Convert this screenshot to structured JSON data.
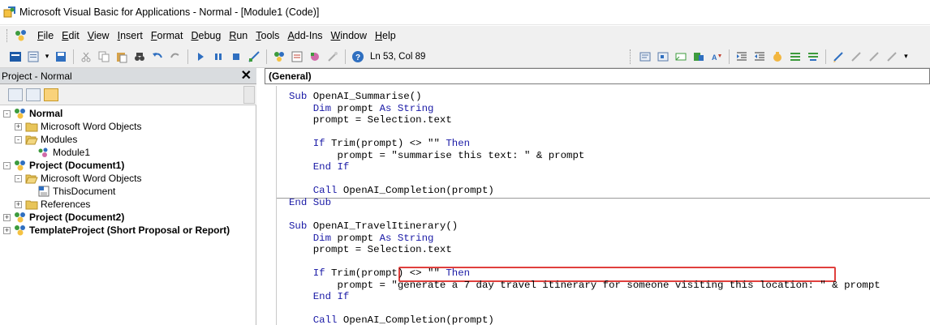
{
  "window": {
    "title": "Microsoft Visual Basic for Applications - Normal - [Module1 (Code)]"
  },
  "menu": {
    "items": [
      "File",
      "Edit",
      "View",
      "Insert",
      "Format",
      "Debug",
      "Run",
      "Tools",
      "Add-Ins",
      "Window",
      "Help"
    ]
  },
  "toolbar": {
    "position": "Ln 53, Col 89"
  },
  "project_pane": {
    "title": "Project - Normal",
    "tree": [
      {
        "label": "Normal",
        "bold": true,
        "expander": "-",
        "icon": "project-icon"
      },
      {
        "label": "Microsoft Word Objects",
        "bold": false,
        "expander": "+",
        "icon": "folder-icon"
      },
      {
        "label": "Modules",
        "bold": false,
        "expander": "-",
        "icon": "open-folder-icon"
      },
      {
        "label": "Module1",
        "bold": false,
        "expander": "",
        "icon": "module-icon"
      },
      {
        "label": "Project (Document1)",
        "bold": true,
        "expander": "-",
        "icon": "project-icon"
      },
      {
        "label": "Microsoft Word Objects",
        "bold": false,
        "expander": "-",
        "icon": "open-folder-icon"
      },
      {
        "label": "ThisDocument",
        "bold": false,
        "expander": "",
        "icon": "document-icon"
      },
      {
        "label": "References",
        "bold": false,
        "expander": "+",
        "icon": "folder-icon"
      },
      {
        "label": "Project (Document2)",
        "bold": true,
        "expander": "+",
        "icon": "project-icon"
      },
      {
        "label": "TemplateProject (Short Proposal or Report)",
        "bold": true,
        "expander": "+",
        "icon": "project-icon"
      }
    ]
  },
  "code_pane": {
    "object_dropdown": "(General)",
    "lines": [
      {
        "kw": "Sub",
        "rest": " OpenAI_Summarise()"
      },
      {
        "pre": "    ",
        "kw": "Dim",
        "rest": " prompt ",
        "kw2": "As String"
      },
      {
        "pre": "    ",
        "rest": "prompt = Selection.text"
      },
      {
        "rest": ""
      },
      {
        "pre": "    ",
        "kw": "If",
        "rest": " Trim(prompt) <> \"\" ",
        "kw2": "Then"
      },
      {
        "pre": "        ",
        "rest": "prompt = \"summarise this text: \" & prompt"
      },
      {
        "pre": "    ",
        "kw": "End If",
        "rest": ""
      },
      {
        "rest": ""
      },
      {
        "pre": "    ",
        "kw": "Call",
        "rest": " OpenAI_Completion(prompt)"
      },
      {
        "kw": "End Sub",
        "rest": ""
      },
      {
        "rest": ""
      },
      {
        "kw": "Sub",
        "rest": " OpenAI_TravelItinerary()"
      },
      {
        "pre": "    ",
        "kw": "Dim",
        "rest": " prompt ",
        "kw2": "As String"
      },
      {
        "pre": "    ",
        "rest": "prompt = Selection.text"
      },
      {
        "rest": ""
      },
      {
        "pre": "    ",
        "kw": "If",
        "rest": " Trim(prompt) <> \"\" ",
        "kw2": "Then"
      },
      {
        "pre": "        ",
        "rest": "prompt = \"generate a 7 day travel itinerary for someone visiting this location: \" & prompt"
      },
      {
        "pre": "    ",
        "kw": "End If",
        "rest": ""
      },
      {
        "rest": ""
      },
      {
        "pre": "    ",
        "kw": "Call",
        "rest": " OpenAI_Completion(prompt)"
      },
      {
        "kw": "End Sub",
        "rest": ""
      }
    ],
    "highlighted_text": "generate a 7 day travel itinerary for someone visiting this location:",
    "highlight_color": "#e0403d",
    "keyword_color": "#1a1aa6"
  }
}
